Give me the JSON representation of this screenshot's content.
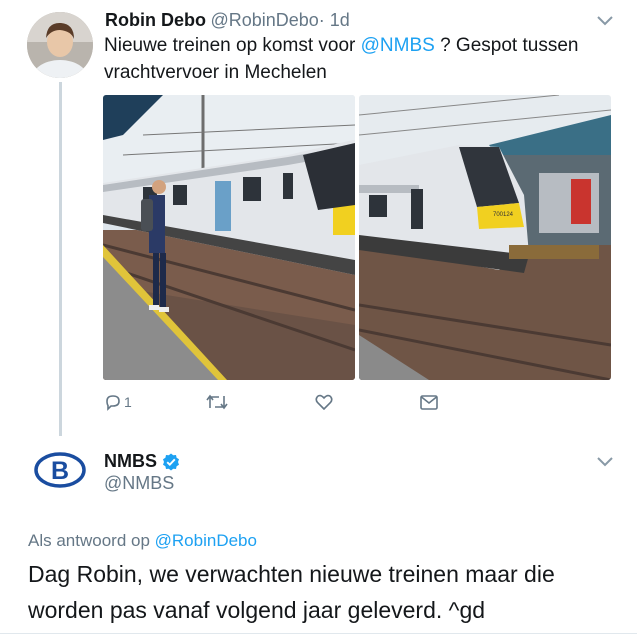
{
  "tweet1": {
    "name": "Robin Debo",
    "handle": "@RobinDebo",
    "time": "· 1d",
    "text_line1_pre": "Nieuwe treinen op komst voor ",
    "text_line1_link": "@NMBS",
    "text_line1_post": " ? Gespot tussen",
    "text_line2": "vrachtvervoer in Mechelen",
    "train_number": "700124",
    "actions": {
      "reply_count": "1"
    }
  },
  "tweet2": {
    "name": "NMBS",
    "handle": "@NMBS",
    "logo_letter": "B",
    "reply_prefix": "Als antwoord op ",
    "reply_to": "@RobinDebo",
    "text_line1": "Dag Robin, we verwachten nieuwe treinen maar die",
    "text_line2": "worden pas vanaf volgend jaar geleverd. ^gd"
  },
  "colors": {
    "link": "#1da1f2",
    "secondary": "#657786",
    "verified": "#1da1f2",
    "nmbs_blue": "#1a4da0"
  }
}
